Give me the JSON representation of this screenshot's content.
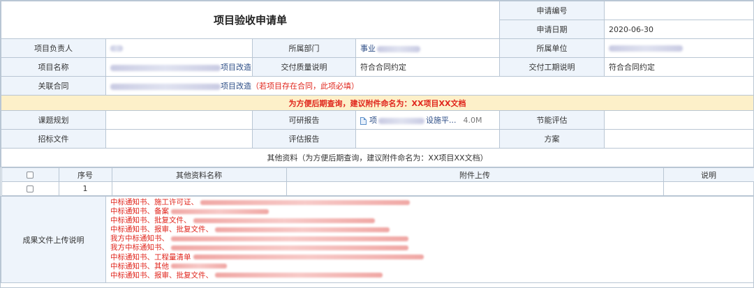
{
  "form": {
    "title": "项目验收申请单",
    "apply_no_label": "申请编号",
    "apply_no_value": "",
    "apply_date_label": "申请日期",
    "apply_date_value": "2020-06-30",
    "manager_label": "项目负责人",
    "dept_label": "所属部门",
    "dept_value": "事业",
    "unit_label": "所属单位",
    "project_name_label": "项目名称",
    "project_name_suffix": "项目改造",
    "delivery_quality_label": "交付质量说明",
    "delivery_quality_value": "符合合同约定",
    "delivery_period_label": "交付工期说明",
    "delivery_period_value": "符合合同约定",
    "contract_label": "关联合同",
    "contract_suffix": "项目改造",
    "contract_note": "（若项目存在合同，此项必填）",
    "tip": "为方便后期查询，建议附件命名为：XX项目XX文档",
    "topic_label": "课题规划",
    "feasibility_label": "可研报告",
    "feasibility_file_prefix": "项",
    "feasibility_file_suffix": "设施平...",
    "feasibility_file_size": "4.0M",
    "energy_label": "节能评估",
    "bidding_label": "招标文件",
    "assessment_label": "评估报告",
    "plan_label": "方案"
  },
  "other": {
    "title": "其他资料（为方便后期查询，建议附件命名为：XX项目XX文档）",
    "columns": [
      "",
      "序号",
      "其他资料名称",
      "附件上传",
      "说明"
    ],
    "rows": [
      {
        "index": "1",
        "name": "",
        "attachment": "",
        "note": ""
      }
    ]
  },
  "results": {
    "label": "成果文件上传说明",
    "lines": [
      "中标通知书、施工许可证、",
      "中标通知书、备案",
      "中标通知书、批复文件、",
      "中标通知书、报审、批复文件、",
      "我方中标通知书、",
      "我方中标通知书、",
      "中标通知书、工程量清单",
      "中标通知书、其他",
      "中标通知书、报审、批复文件、"
    ]
  }
}
